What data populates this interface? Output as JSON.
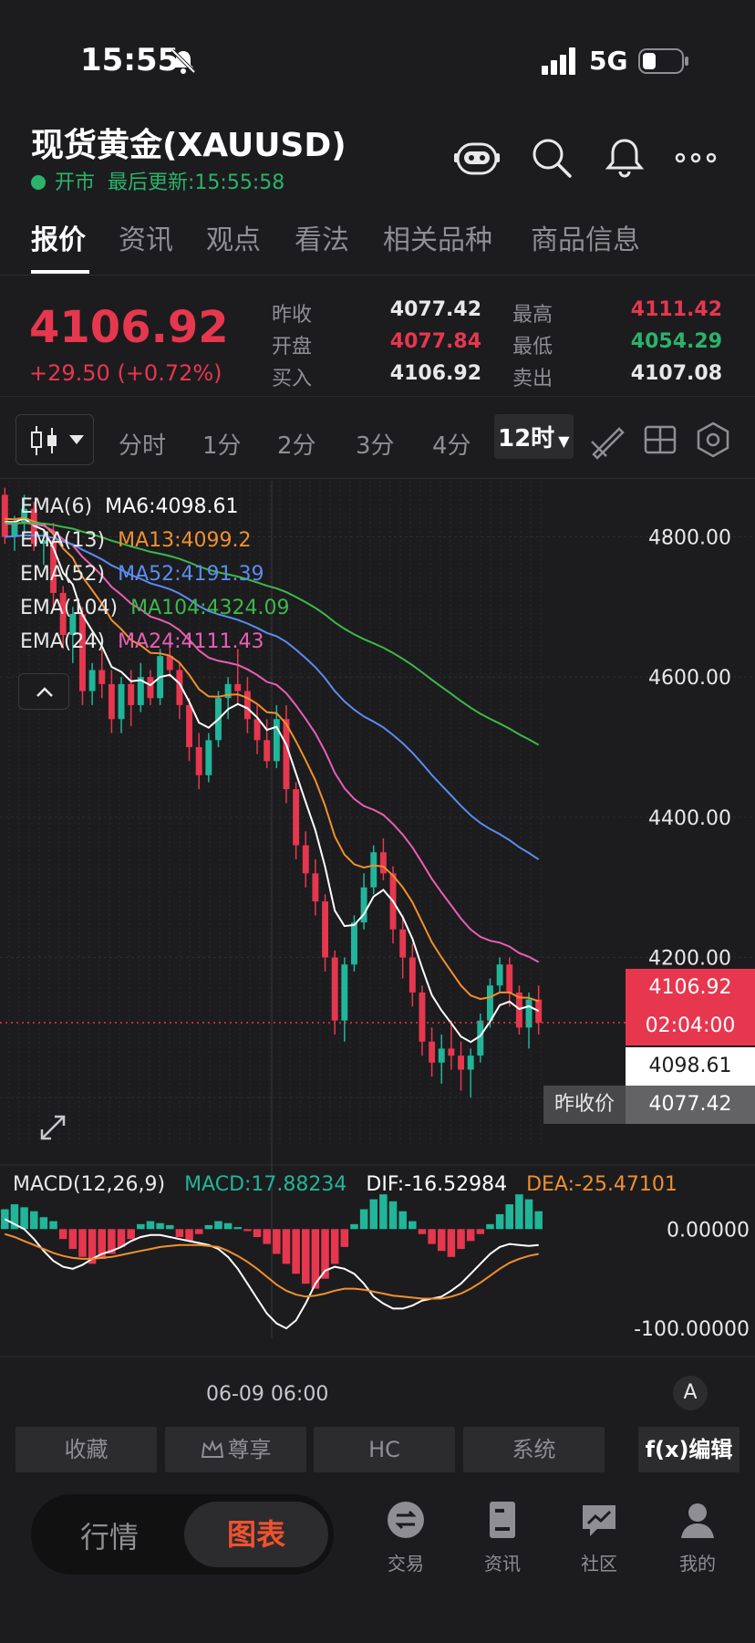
{
  "status": {
    "time": "15:55",
    "network": "5G"
  },
  "header": {
    "title": "现货黄金(XAUUSD)",
    "market_state": "开市",
    "updated": "最后更新:15:55:58"
  },
  "tabs": [
    "报价",
    "资讯",
    "观点",
    "看法",
    "相关品种",
    "商品信息"
  ],
  "quote": {
    "price": "4106.92",
    "change": "+29.50 (+0.72%)",
    "prev_close_label": "昨收",
    "prev_close": "4077.42",
    "open_label": "开盘",
    "open": "4077.84",
    "bid_label": "买入",
    "bid": "4106.92",
    "high_label": "最高",
    "high": "4111.42",
    "low_label": "最低",
    "low": "4054.29",
    "ask_label": "卖出",
    "ask": "4107.08"
  },
  "periods": [
    "分时",
    "1分",
    "2分",
    "3分",
    "4分",
    "12时"
  ],
  "ma_legend": [
    {
      "label": "EMA(6)",
      "value": "MA6:4098.61",
      "color": "#ffffff"
    },
    {
      "label": "EMA(13)",
      "value": "MA13:4099.2",
      "color": "#f0902e"
    },
    {
      "label": "EMA(52)",
      "value": "MA52:4191.39",
      "color": "#5b8cf0"
    },
    {
      "label": "EMA(104)",
      "value": "MA104:4324.09",
      "color": "#3db84a"
    },
    {
      "label": "EMA(24)",
      "value": "MA24:4111.43",
      "color": "#e85fb5"
    }
  ],
  "chart_data": [
    {
      "type": "candlestick",
      "title": "",
      "y_ticks": [
        "4800.00",
        "4600.00",
        "4400.00",
        "4200.00"
      ],
      "ylim": [
        3930,
        4880
      ],
      "current_price": 4106.92,
      "countdown": "02:04:00",
      "ema6_last": "4098.61",
      "prev_close_label": "昨收价",
      "prev_close": "4077.42",
      "x_label": "06-09 06:00",
      "candles": [
        [
          4860,
          4870,
          4790,
          4800
        ],
        [
          4800,
          4830,
          4780,
          4820
        ],
        [
          4820,
          4860,
          4800,
          4840
        ],
        [
          4840,
          4850,
          4780,
          4790
        ],
        [
          4790,
          4810,
          4760,
          4795
        ],
        [
          4795,
          4820,
          4700,
          4720
        ],
        [
          4720,
          4730,
          4640,
          4660
        ],
        [
          4660,
          4700,
          4620,
          4690
        ],
        [
          4690,
          4700,
          4560,
          4580
        ],
        [
          4580,
          4620,
          4560,
          4610
        ],
        [
          4610,
          4640,
          4570,
          4590
        ],
        [
          4590,
          4610,
          4520,
          4540
        ],
        [
          4540,
          4600,
          4520,
          4590
        ],
        [
          4590,
          4610,
          4530,
          4560
        ],
        [
          4560,
          4620,
          4550,
          4600
        ],
        [
          4600,
          4610,
          4560,
          4570
        ],
        [
          4570,
          4640,
          4560,
          4630
        ],
        [
          4630,
          4650,
          4600,
          4610
        ],
        [
          4610,
          4620,
          4540,
          4560
        ],
        [
          4560,
          4570,
          4480,
          4500
        ],
        [
          4500,
          4520,
          4440,
          4460
        ],
        [
          4460,
          4520,
          4450,
          4510
        ],
        [
          4510,
          4580,
          4500,
          4570
        ],
        [
          4570,
          4600,
          4540,
          4590
        ],
        [
          4590,
          4640,
          4560,
          4580
        ],
        [
          4580,
          4600,
          4520,
          4540
        ],
        [
          4540,
          4560,
          4490,
          4510
        ],
        [
          4510,
          4540,
          4470,
          4480
        ],
        [
          4480,
          4560,
          4470,
          4540
        ],
        [
          4540,
          4560,
          4420,
          4440
        ],
        [
          4440,
          4450,
          4340,
          4360
        ],
        [
          4360,
          4380,
          4300,
          4320
        ],
        [
          4320,
          4340,
          4260,
          4280
        ],
        [
          4280,
          4290,
          4180,
          4200
        ],
        [
          4200,
          4210,
          4090,
          4110
        ],
        [
          4110,
          4200,
          4080,
          4190
        ],
        [
          4190,
          4260,
          4180,
          4250
        ],
        [
          4250,
          4320,
          4240,
          4300
        ],
        [
          4300,
          4360,
          4290,
          4350
        ],
        [
          4350,
          4370,
          4310,
          4320
        ],
        [
          4320,
          4330,
          4220,
          4240
        ],
        [
          4240,
          4260,
          4170,
          4200
        ],
        [
          4200,
          4220,
          4130,
          4150
        ],
        [
          4150,
          4160,
          4060,
          4080
        ],
        [
          4080,
          4100,
          4030,
          4050
        ],
        [
          4050,
          4090,
          4020,
          4070
        ],
        [
          4070,
          4110,
          4040,
          4060
        ],
        [
          4060,
          4080,
          4010,
          4040
        ],
        [
          4040,
          4070,
          4000,
          4060
        ],
        [
          4060,
          4120,
          4050,
          4110
        ],
        [
          4110,
          4170,
          4100,
          4160
        ],
        [
          4160,
          4200,
          4150,
          4190
        ],
        [
          4190,
          4200,
          4130,
          4150
        ],
        [
          4150,
          4160,
          4090,
          4100
        ],
        [
          4100,
          4150,
          4070,
          4140
        ],
        [
          4140,
          4160,
          4090,
          4107
        ]
      ]
    },
    {
      "type": "macd",
      "params": "MACD(12,26,9)",
      "macd": "MACD:17.88234",
      "dif": "DIF:-16.52984",
      "dea": "DEA:-25.47101",
      "y_ticks": [
        "0.00000",
        "-100.00000"
      ],
      "ylim": [
        -110,
        60
      ],
      "histogram": [
        20,
        25,
        22,
        18,
        12,
        8,
        -10,
        -20,
        -28,
        -35,
        -30,
        -25,
        -18,
        -10,
        5,
        8,
        6,
        4,
        -8,
        -12,
        -5,
        4,
        8,
        6,
        2,
        -2,
        -8,
        -15,
        -25,
        -35,
        -45,
        -55,
        -60,
        -50,
        -35,
        -18,
        5,
        20,
        30,
        35,
        28,
        18,
        8,
        -5,
        -15,
        -22,
        -28,
        -20,
        -12,
        -5,
        5,
        15,
        25,
        35,
        30,
        18
      ],
      "dif_line": [
        10,
        5,
        0,
        -10,
        -22,
        -32,
        -38,
        -40,
        -36,
        -30,
        -25,
        -22,
        -18,
        -12,
        -8,
        -6,
        -6,
        -8,
        -10,
        -12,
        -14,
        -16,
        -20,
        -28,
        -40,
        -55,
        -70,
        -85,
        -95,
        -100,
        -92,
        -75,
        -55,
        -42,
        -38,
        -40,
        -45,
        -55,
        -68,
        -75,
        -80,
        -80,
        -77,
        -72,
        -70,
        -68,
        -62,
        -55,
        -45,
        -35,
        -25,
        -18,
        -15,
        -16,
        -17,
        -16
      ],
      "dea_line": [
        -5,
        -8,
        -12,
        -16,
        -20,
        -24,
        -27,
        -29,
        -30,
        -30,
        -29,
        -28,
        -26,
        -24,
        -22,
        -20,
        -18,
        -17,
        -16,
        -16,
        -16,
        -17,
        -18,
        -22,
        -27,
        -33,
        -40,
        -48,
        -56,
        -62,
        -66,
        -68,
        -67,
        -65,
        -62,
        -60,
        -60,
        -61,
        -63,
        -65,
        -67,
        -68,
        -69,
        -70,
        -70,
        -70,
        -68,
        -65,
        -60,
        -54,
        -47,
        -40,
        -34,
        -30,
        -27,
        -25
      ]
    }
  ],
  "bottom_tools": [
    "收藏",
    "尊享",
    "HC",
    "系统",
    "f(x)编辑"
  ],
  "auto_button": "A",
  "nav": {
    "seg_off": "行情",
    "seg_on": "图表",
    "items": [
      "交易",
      "资讯",
      "社区",
      "我的"
    ]
  }
}
